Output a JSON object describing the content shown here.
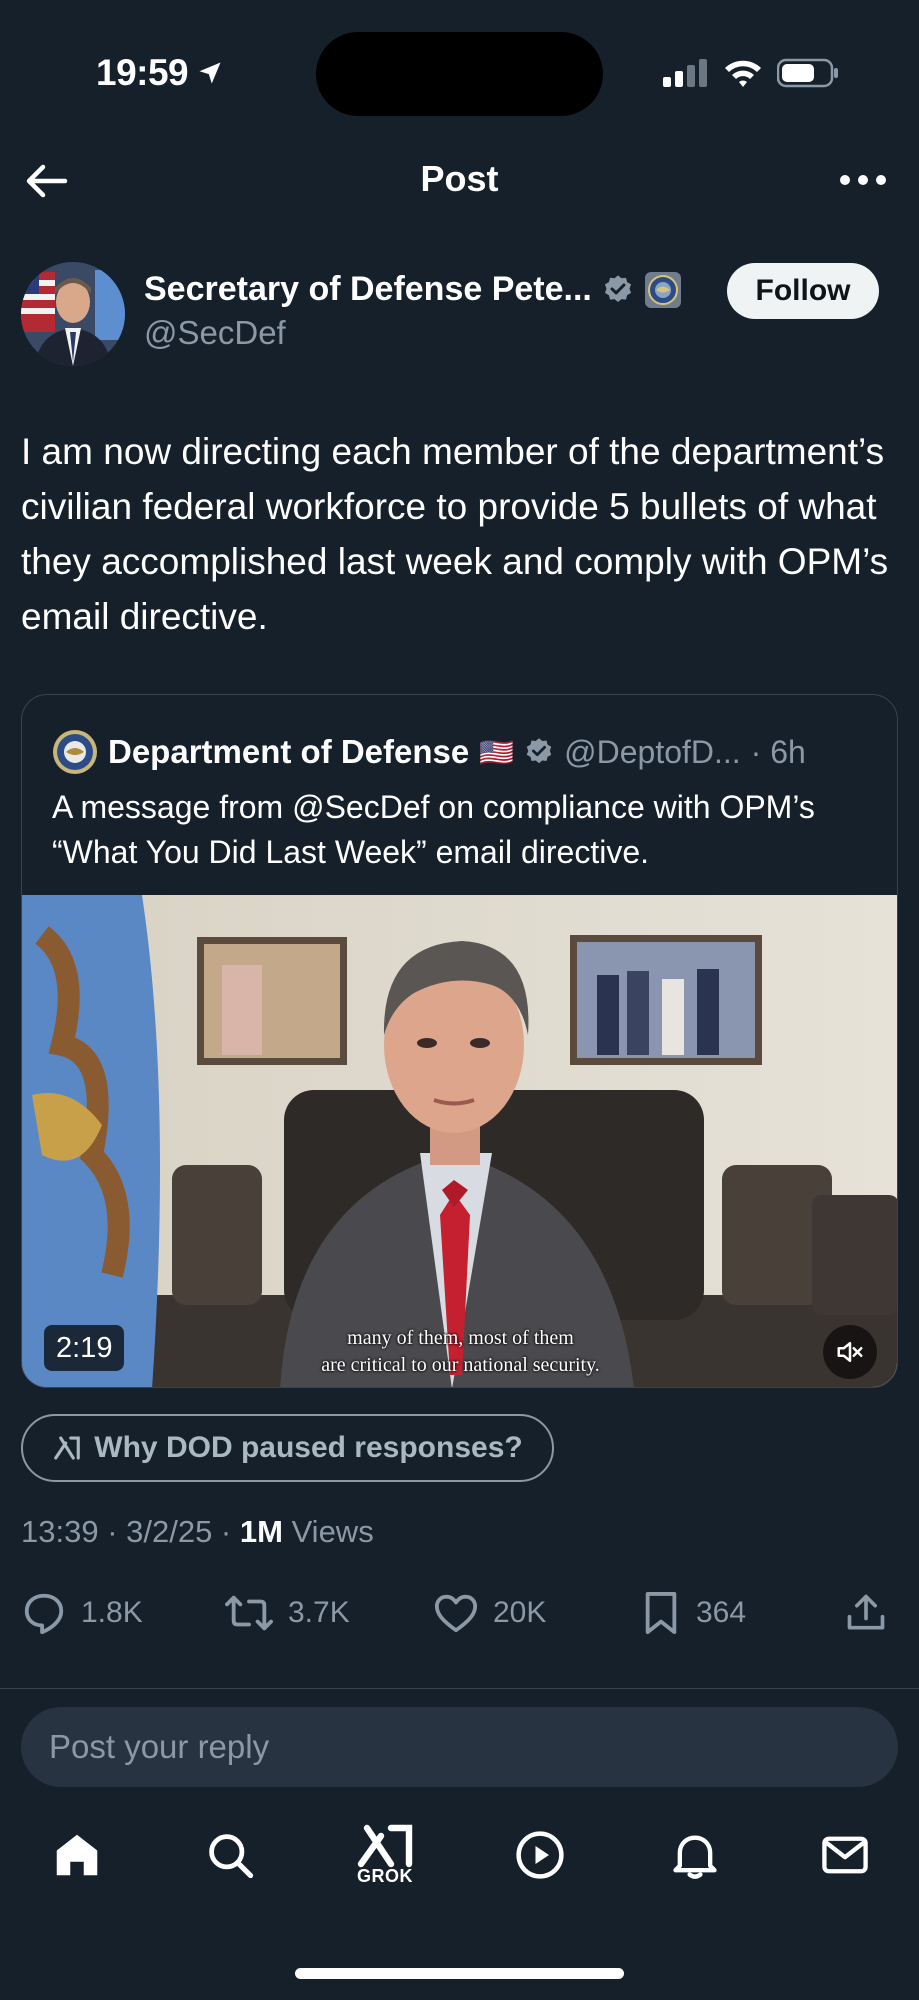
{
  "status_bar": {
    "time": "19:59"
  },
  "header": {
    "title": "Post"
  },
  "author": {
    "name": "Secretary of Defense Pete...",
    "handle": "@SecDef",
    "follow_label": "Follow"
  },
  "post": {
    "text": "I am now directing each member of the department’s civilian federal workforce to provide 5 bullets of what they accomplished last week and comply with OPM’s email directive.",
    "timestamp": "13:39 · 3/2/25 · ",
    "views_count": "1M",
    "views_label": " Views"
  },
  "quoted": {
    "name": "Department of Defense",
    "flag": "🇺🇸",
    "handle": "@DeptofD...",
    "time": "· 6h",
    "text": "A message from @SecDef on compliance with OPM’s “What You Did Last Week” email directive.",
    "video": {
      "duration": "2:19",
      "caption_line1": "many of them, most of them",
      "caption_line2": "are critical to our national security."
    }
  },
  "grok_chip": {
    "label": "Why DOD paused responses?"
  },
  "actions": {
    "replies": "1.8K",
    "reposts": "3.7K",
    "likes": "20K",
    "bookmarks": "364"
  },
  "reply": {
    "placeholder": "Post your reply"
  },
  "tabbar": {
    "grok_label": "GROK"
  },
  "icons": [
    "back-arrow-icon",
    "more-icon",
    "verified-icon",
    "dod-seal-icon",
    "mute-icon",
    "grok-icon",
    "reply-icon",
    "repost-icon",
    "like-icon",
    "bookmark-icon",
    "share-icon",
    "home-icon",
    "search-icon",
    "play-icon",
    "bell-icon",
    "mail-icon"
  ],
  "colors": {
    "background": "#15202b",
    "verified": "#8b98a5",
    "muted_text": "#8b98a5"
  }
}
